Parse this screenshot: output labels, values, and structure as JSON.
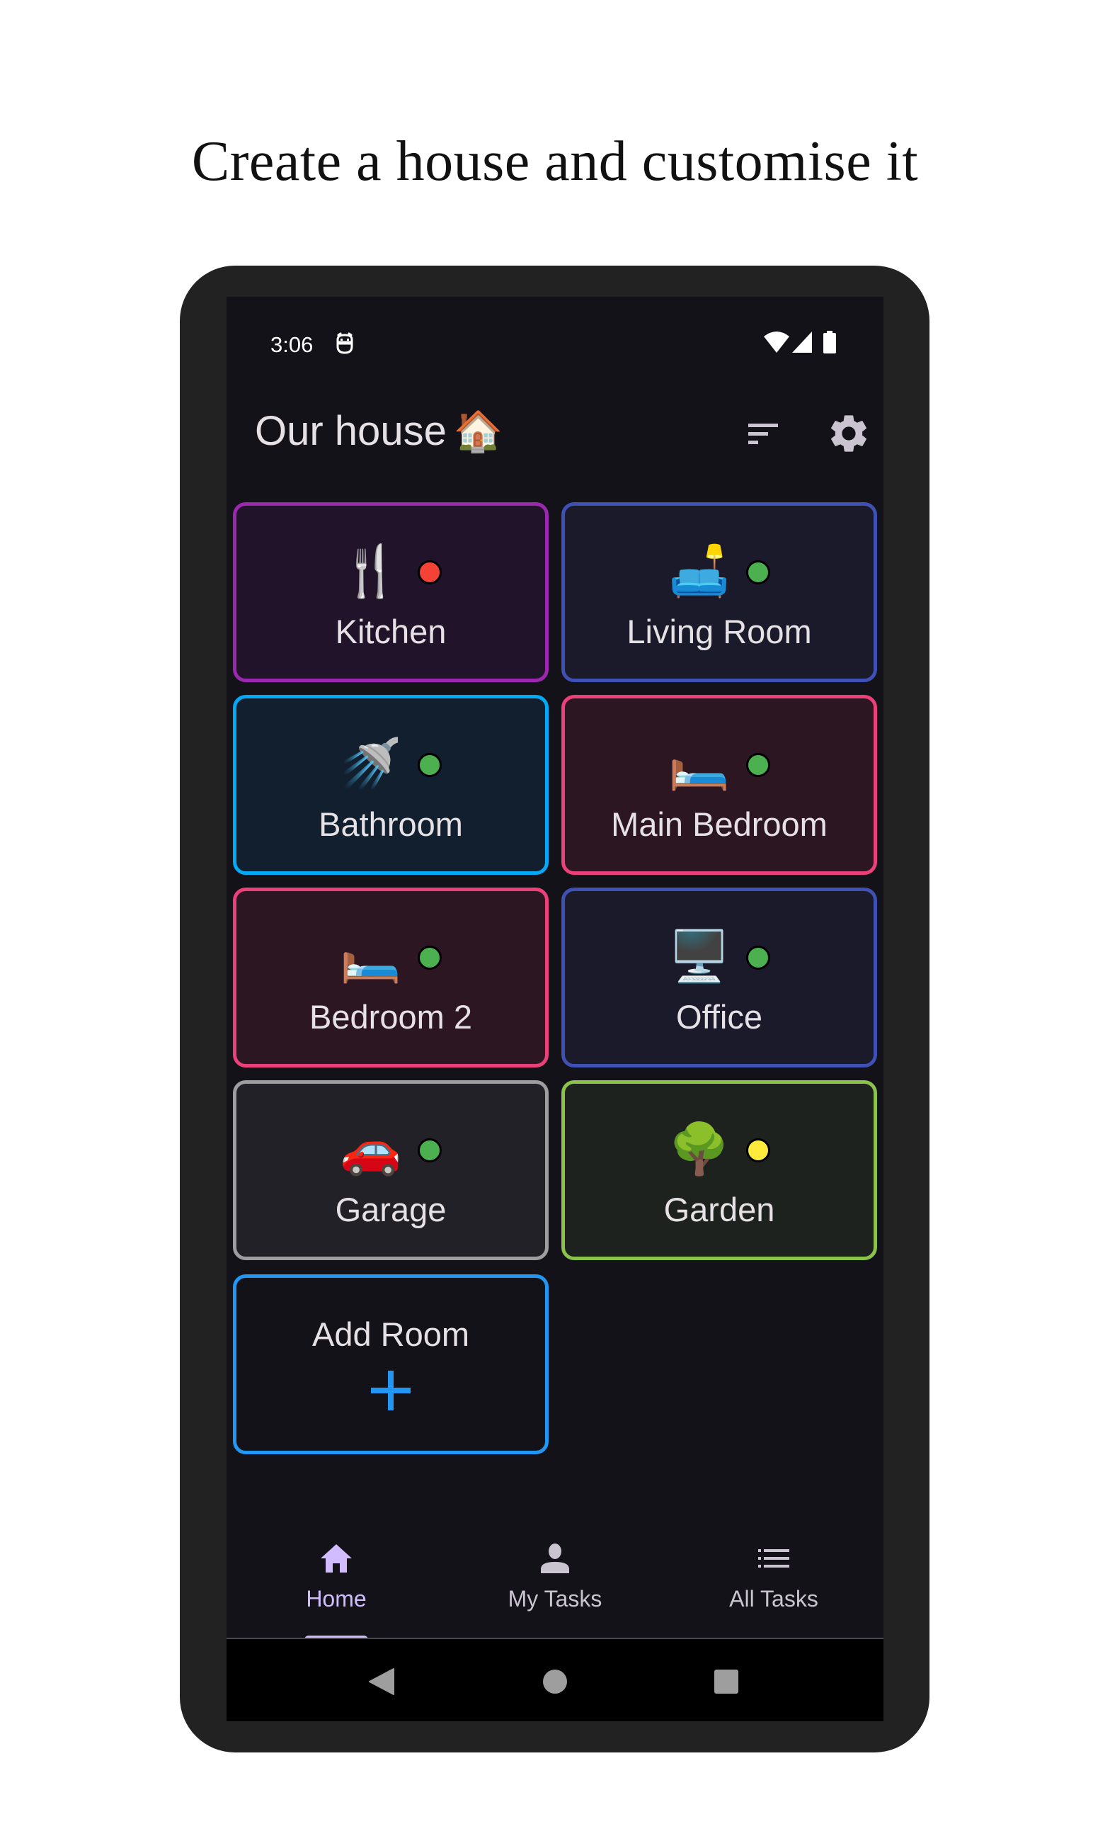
{
  "headline": "Create a house and customise it",
  "status_bar": {
    "time": "3:06",
    "left_icons": [
      "app-notification-icon"
    ],
    "right_icons": [
      "wifi-icon",
      "cell-signal-icon",
      "battery-icon"
    ]
  },
  "app_bar": {
    "title": "Our house",
    "title_emoji": "🏠",
    "actions": [
      {
        "name": "sort",
        "icon": "sort-icon"
      },
      {
        "name": "settings",
        "icon": "gear-icon"
      }
    ]
  },
  "rooms": [
    {
      "name": "Kitchen",
      "emoji": "🍴",
      "status": "red",
      "status_color": "#f44336",
      "border_color": "#9c27b0",
      "background": "#21142a"
    },
    {
      "name": "Living Room",
      "emoji": "🛋️",
      "status": "green",
      "status_color": "#4caf50",
      "border_color": "#3f51b5",
      "background": "#1a1a2a"
    },
    {
      "name": "Bathroom",
      "emoji": "🚿",
      "status": "green",
      "status_color": "#4caf50",
      "border_color": "#03a9f4",
      "background": "#111f2e"
    },
    {
      "name": "Main Bedroom",
      "emoji": "🛏️",
      "status": "green",
      "status_color": "#4caf50",
      "border_color": "#ec407a",
      "background": "#2b1622"
    },
    {
      "name": "Bedroom 2",
      "emoji": "🛏️",
      "status": "green",
      "status_color": "#4caf50",
      "border_color": "#ec407a",
      "background": "#2b1622"
    },
    {
      "name": "Office",
      "emoji": "🖥️",
      "status": "green",
      "status_color": "#4caf50",
      "border_color": "#3f51b5",
      "background": "#1a1a2a"
    },
    {
      "name": "Garage",
      "emoji": "🚗",
      "status": "green",
      "status_color": "#4caf50",
      "border_color": "#9e9e9e",
      "background": "#222127"
    },
    {
      "name": "Garden",
      "emoji": "🌳",
      "status": "yellow",
      "status_color": "#ffeb3b",
      "border_color": "#8bc34a",
      "background": "#1e221e"
    }
  ],
  "add_room": {
    "label": "Add Room",
    "icon": "plus-icon",
    "accent": "#2196f3"
  },
  "bottom_nav": {
    "active": "Home",
    "items": [
      {
        "label": "Home",
        "icon": "home-icon"
      },
      {
        "label": "My Tasks",
        "icon": "person-icon"
      },
      {
        "label": "All Tasks",
        "icon": "list-icon"
      }
    ]
  },
  "system_nav": [
    "back",
    "home",
    "recents"
  ],
  "colors": {
    "accent": "#d0bcff",
    "screen_background": "#131218",
    "frame": "#222222",
    "on_surface": "#e6e1e5",
    "on_surface_variant": "#cac4d0"
  }
}
